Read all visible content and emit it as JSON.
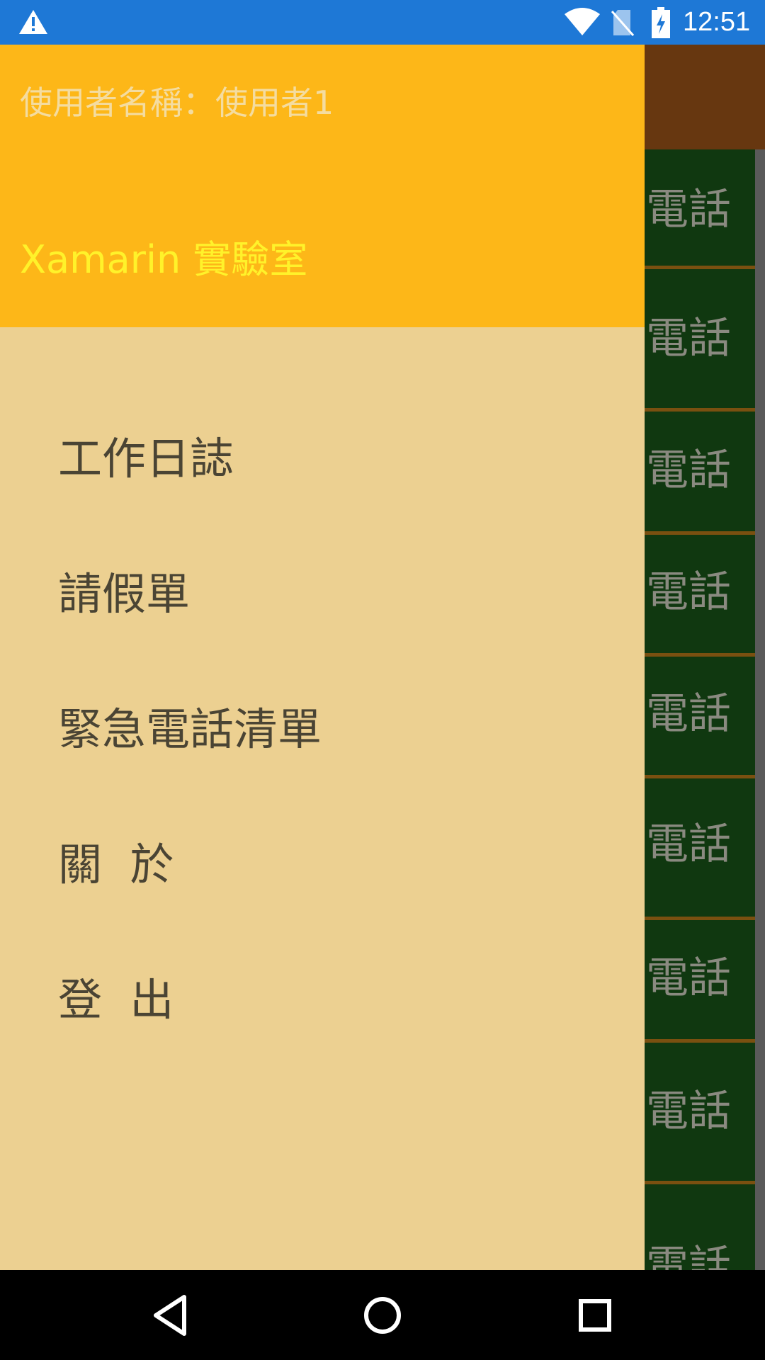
{
  "status_bar": {
    "time": "12:51",
    "icons": [
      "warning-icon",
      "wifi-icon",
      "no-sim-icon",
      "battery-charging-icon"
    ]
  },
  "background_list": {
    "row_label": "電話",
    "rows": [
      "電話",
      "電話",
      "電話",
      "電話",
      "電話",
      "電話",
      "電話",
      "電話",
      "電話"
    ]
  },
  "drawer": {
    "username": "使用者名稱：使用者1",
    "title": "Xamarin 實驗室",
    "menu": [
      {
        "label": "工作日誌"
      },
      {
        "label": "請假單"
      },
      {
        "label": "緊急電話清單"
      },
      {
        "label": "關  於"
      },
      {
        "label": "登  出"
      }
    ]
  },
  "nav_bar": {
    "icons": [
      "back-icon",
      "home-icon",
      "recents-icon"
    ]
  },
  "colors": {
    "status_bar": "#1e78d6",
    "drawer_header": "#fdb718",
    "drawer_body": "#ecd091",
    "app_toolbar": "#673710",
    "list_row": "#103810",
    "title_text": "#fff22a"
  }
}
